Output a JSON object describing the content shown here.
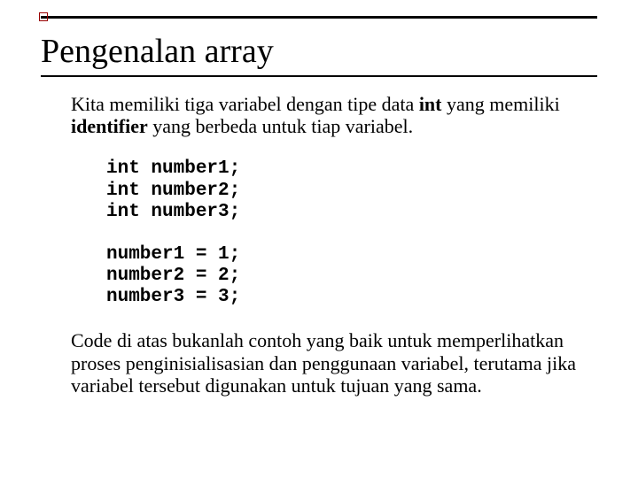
{
  "title": "Pengenalan array",
  "p1": {
    "t1": "Kita memiliki tiga variabel dengan tipe data ",
    "b1": "int",
    "t2": " yang memiliki ",
    "b2": "identifier",
    "t3": " yang berbeda untuk tiap variabel."
  },
  "code1": "int number1;\nint number2;\nint number3;",
  "code2": "number1 = 1;\nnumber2 = 2;\nnumber3 = 3;",
  "p2": "Code di atas bukanlah contoh yang baik untuk memperlihatkan proses penginisialisasian dan penggunaan variabel, terutama jika variabel tersebut digunakan untuk tujuan yang sama."
}
